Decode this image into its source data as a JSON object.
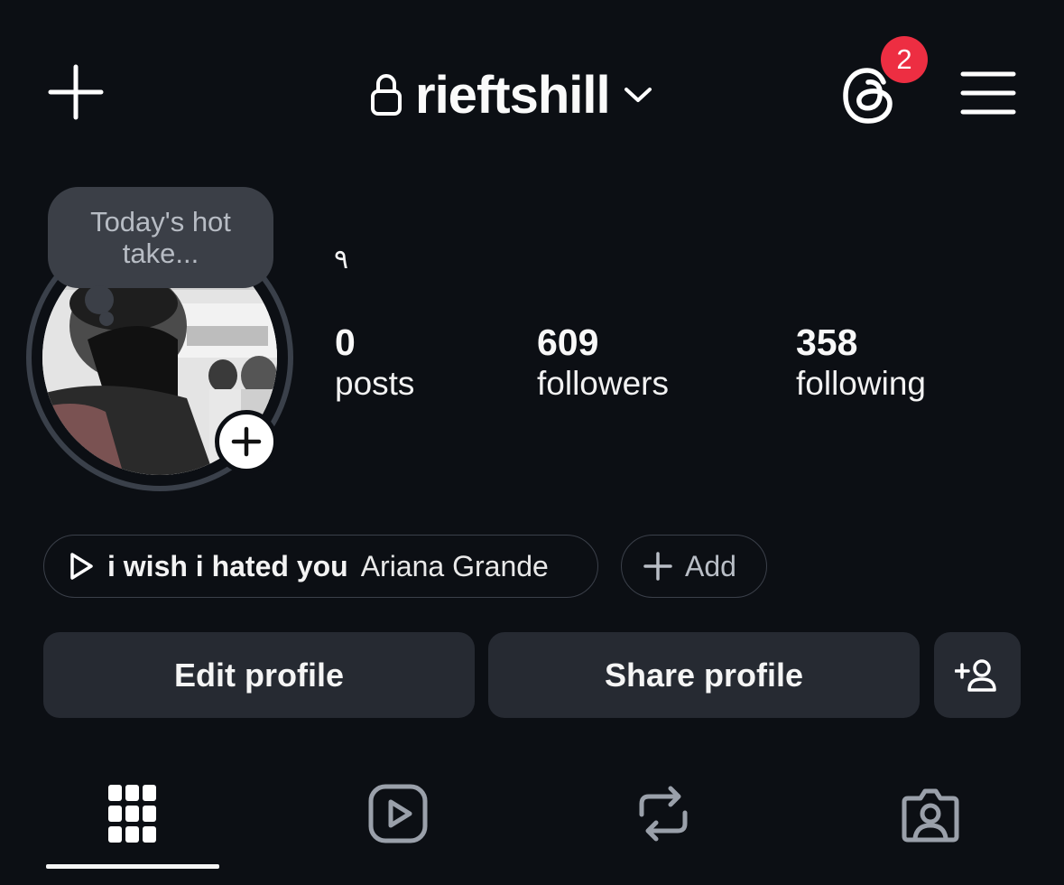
{
  "header": {
    "create_icon": "plus-icon",
    "lock_icon": "lock-icon",
    "username": "rieftshill",
    "dropdown_icon": "chevron-down-icon",
    "threads_icon": "threads-icon",
    "threads_badge": "2",
    "menu_icon": "hamburger-menu-icon"
  },
  "note": {
    "text": "Today's hot take..."
  },
  "profile": {
    "display_name": "٩",
    "stats": [
      {
        "value": "0",
        "label": "posts"
      },
      {
        "value": "609",
        "label": "followers"
      },
      {
        "value": "358",
        "label": "following"
      }
    ]
  },
  "music": {
    "song": "i wish i hated you",
    "artist": "Ariana Grande",
    "play_icon": "play-icon"
  },
  "add_link": {
    "label": "Add",
    "icon": "plus-icon"
  },
  "actions": {
    "edit_label": "Edit profile",
    "share_label": "Share profile",
    "discover_icon": "add-person-icon"
  },
  "tabs": [
    {
      "icon": "grid-icon",
      "active": true
    },
    {
      "icon": "reels-icon",
      "active": false
    },
    {
      "icon": "reposts-icon",
      "active": false
    },
    {
      "icon": "tagged-icon",
      "active": false
    }
  ],
  "colors": {
    "background": "#0c0f14",
    "badge": "#ed2e42",
    "button": "#262a32",
    "note": "#3b3f47"
  }
}
